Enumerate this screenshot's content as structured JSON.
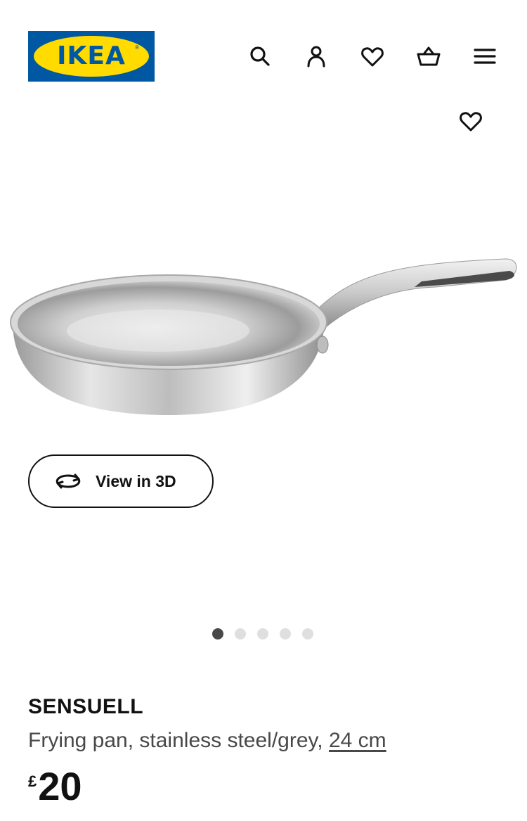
{
  "header": {
    "logo_text": "IKEA",
    "icons": [
      "search-icon",
      "user-icon",
      "heart-icon",
      "basket-icon",
      "menu-icon"
    ]
  },
  "gallery": {
    "favourite_icon": "heart-icon",
    "view3d_label": "View in 3D",
    "view3d_icon": "rotate-icon",
    "dots_total": 5,
    "active_dot": 1
  },
  "product": {
    "name": "SENSUELL",
    "description": "Frying pan, stainless steel/grey, ",
    "size": "24 cm",
    "currency": "£",
    "price": "20"
  },
  "colors": {
    "brand_blue": "#0058a3",
    "brand_yellow": "#ffdb00",
    "text": "#111111",
    "secondary_text": "#484848",
    "dot_active": "#484848",
    "dot_inactive": "#dfdfdf"
  }
}
